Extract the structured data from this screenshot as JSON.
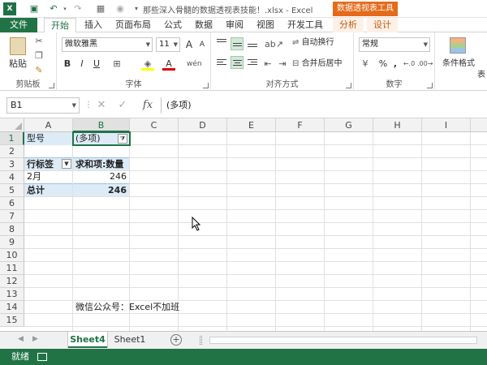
{
  "window": {
    "title": "那些深入骨髓的数据透视表技能！.xlsx - Excel",
    "context_title": "数据透视表工具"
  },
  "tabs": {
    "file": "文件",
    "items": [
      "开始",
      "插入",
      "页面布局",
      "公式",
      "数据",
      "审阅",
      "视图",
      "开发工具"
    ],
    "context": [
      "分析",
      "设计"
    ]
  },
  "ribbon": {
    "clipboard": {
      "paste": "粘贴",
      "label": "剪贴板"
    },
    "font": {
      "name": "微软雅黑",
      "size": "11",
      "grow": "A",
      "shrink": "A",
      "bold": "B",
      "italic": "I",
      "underline": "U",
      "label": "字体"
    },
    "align": {
      "wrap": "自动换行",
      "merge": "合并后居中",
      "label": "对齐方式"
    },
    "number": {
      "format": "常规",
      "percent": "%",
      "comma": ",",
      "label": "数字"
    },
    "styles": {
      "conditional": "条件格式",
      "table": "表"
    }
  },
  "formula_bar": {
    "name_box": "B1",
    "content": "(多项)",
    "fx": "fx"
  },
  "grid": {
    "columns": [
      "A",
      "B",
      "C",
      "D",
      "E",
      "F",
      "G",
      "H",
      "I"
    ],
    "rows": [
      "1",
      "2",
      "3",
      "4",
      "5",
      "6",
      "7",
      "8",
      "9",
      "10",
      "11",
      "12",
      "13",
      "14",
      "15"
    ],
    "cells": {
      "A1": "型号",
      "B1": "(多项)",
      "A3": "行标签",
      "B3": "求和项:数量",
      "A4": "2月",
      "B4": "246",
      "A5": "总计",
      "B5": "246",
      "B14": "微信公众号：Excel不加班"
    }
  },
  "sheets": {
    "tabs": [
      "Sheet4",
      "Sheet1"
    ],
    "active": "Sheet4",
    "add": "+"
  },
  "status": {
    "text": "就绪"
  },
  "colors": {
    "excel_green": "#217346",
    "pivot_blue": "#ddebf7",
    "context_orange": "#e56a1a"
  }
}
